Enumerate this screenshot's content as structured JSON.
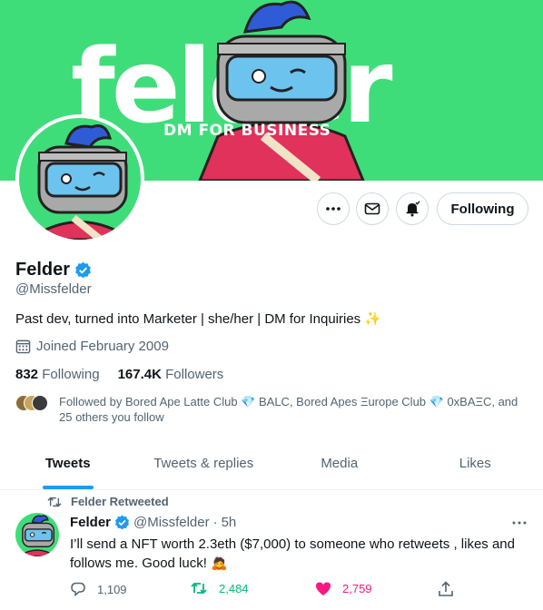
{
  "banner": {
    "word": "felder",
    "tagline": "DM FOR BUSINESS"
  },
  "actions": {
    "following_label": "Following"
  },
  "profile": {
    "name": "Felder",
    "handle": "@Missfelder",
    "bio": "Past dev, turned into Marketer | she/her | DM for Inquiries ✨",
    "joined": "Joined February 2009",
    "following_count": "832",
    "following_label": "Following",
    "followers_count": "167.4K",
    "followers_label": "Followers",
    "followed_by": "Followed by Bored Ape Latte Club 💎 BALC, Bored Apes Ξurope Club 💎 0xBAΞC, and 25 others you follow"
  },
  "tabs": [
    {
      "label": "Tweets",
      "active": true
    },
    {
      "label": "Tweets & replies"
    },
    {
      "label": "Media"
    },
    {
      "label": "Likes"
    }
  ],
  "tweet": {
    "retweet_label": "Felder Retweeted",
    "author": "Felder",
    "handle": "@Missfelder",
    "time": "5h",
    "text": "I’ll send a NFT worth 2.3eth ($7,000) to someone who retweets , likes and follows me. Good luck! 🙇",
    "replies": "1,109",
    "retweets": "2,484",
    "likes": "2,759"
  },
  "colors": {
    "banner_green": "#3fdd7a",
    "accent_blue": "#1d9bf0",
    "retweet_green": "#00ba7c",
    "like_pink": "#f91880"
  },
  "icons": {
    "more": "more-icon",
    "message": "mail-icon",
    "notifications": "bell-icon",
    "verified": "verified-badge-icon",
    "calendar": "calendar-icon",
    "retweet": "retweet-icon",
    "reply": "reply-icon",
    "like": "heart-icon",
    "share": "share-icon"
  }
}
